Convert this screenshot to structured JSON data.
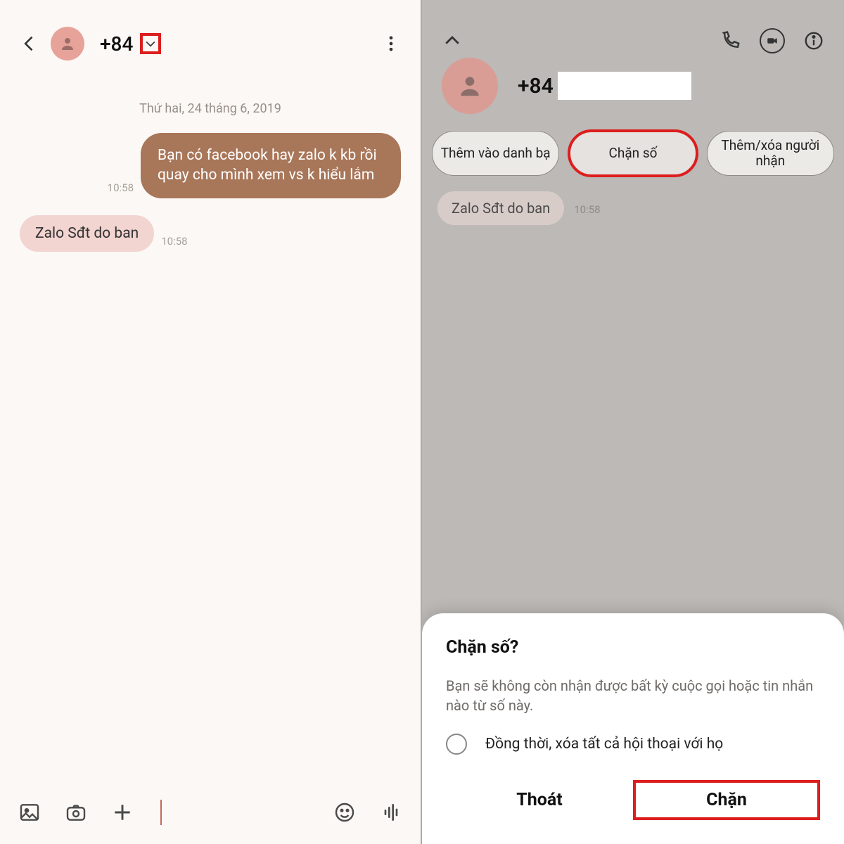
{
  "left": {
    "phone": "+84",
    "date": "Thứ hai, 24 tháng 6, 2019",
    "messages": {
      "out": {
        "text": "Bạn có facebook hay zalo k kb rồi quay cho mình xem vs k hiểu lắm",
        "time": "10:58"
      },
      "in": {
        "text": "Zalo Sđt do ban",
        "time": "10:58"
      }
    }
  },
  "right": {
    "phone": "+84",
    "pills": {
      "add_contact": "Thêm vào danh bạ",
      "block": "Chặn số",
      "edit_recip": "Thêm/xóa người nhận"
    },
    "msg": {
      "text": "Zalo Sđt do ban",
      "time": "10:58"
    },
    "sheet": {
      "title": "Chặn số?",
      "body": "Bạn sẽ không còn nhận được bất kỳ cuộc gọi hoặc tin nhắn nào từ số này.",
      "option": "Đồng thời, xóa tất cả hội thoại với họ",
      "cancel": "Thoát",
      "confirm": "Chặn"
    }
  }
}
